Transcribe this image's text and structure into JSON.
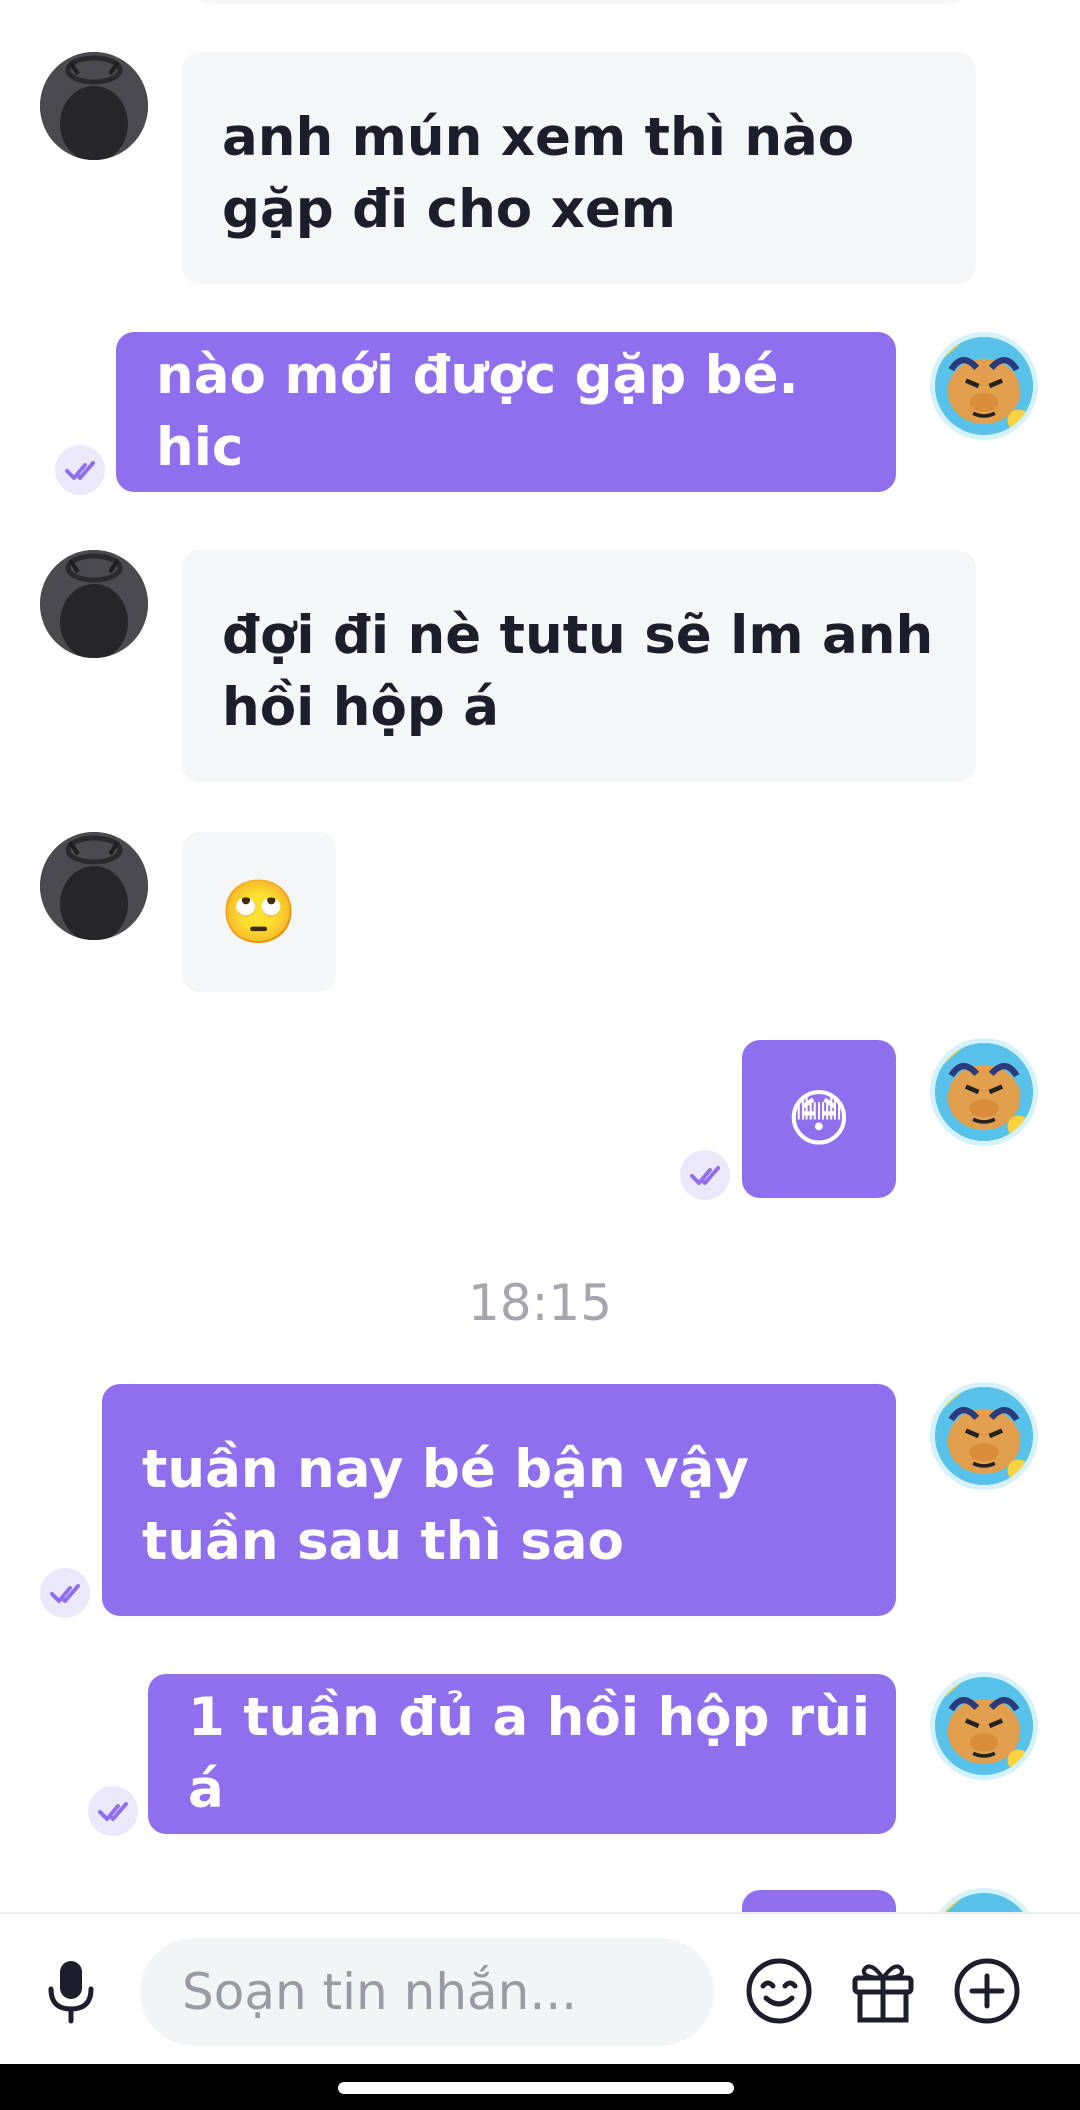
{
  "messages": [
    {
      "text": "anh mún xem thì nào gặp đi cho xem"
    },
    {
      "text": "nào mới được gặp bé. hic"
    },
    {
      "text": "đợi đi nè tutu sẽ lm anh hồi hộp á"
    },
    {
      "text": "🙄"
    },
    {
      "text": "😳"
    },
    {
      "text": "tuần nay bé bận vậy tuần sau thì sao"
    },
    {
      "text": "1 tuần đủ a hồi hộp rùi á"
    }
  ],
  "timestamp": "18:15",
  "composer": {
    "placeholder": "Soạn tin nhắn..."
  },
  "colors": {
    "outgoing_bubble": "#8f6fee",
    "incoming_bubble": "#f5f6f8",
    "seen_check": "#8f6fee"
  },
  "icons": {
    "sender_avatar": "user-avatar-icon",
    "self_avatar": "bull-sticker-avatar",
    "seen": "double-check-icon",
    "mic": "microphone-icon",
    "emoji": "emoji-icon",
    "gift": "gift-icon",
    "add": "plus-circle-icon"
  }
}
